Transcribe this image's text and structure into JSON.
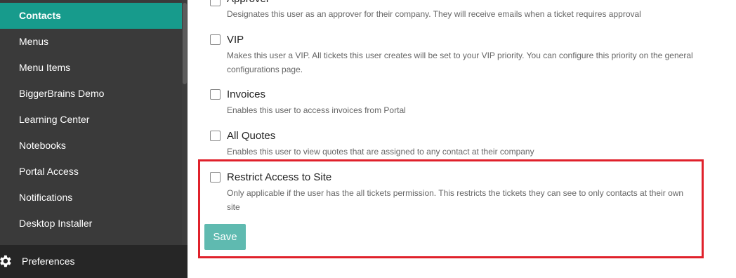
{
  "sidebar": {
    "items": [
      {
        "label": "Contacts",
        "active": true
      },
      {
        "label": "Menus"
      },
      {
        "label": "Menu Items"
      },
      {
        "label": "BiggerBrains Demo"
      },
      {
        "label": "Learning Center"
      },
      {
        "label": "Notebooks"
      },
      {
        "label": "Portal Access"
      },
      {
        "label": "Notifications"
      },
      {
        "label": "Desktop Installer"
      }
    ],
    "preferences": {
      "label": "Preferences",
      "icon": "gear-icon"
    }
  },
  "options": [
    {
      "title": "Approver",
      "description": "Designates this user as an approver for their company. They will receive emails when a ticket requires approval",
      "checked": false
    },
    {
      "title": "VIP",
      "description": "Makes this user a VIP. All tickets this user creates will be set to your VIP priority. You can configure this priority on the general configurations page.",
      "checked": false
    },
    {
      "title": "Invoices",
      "description": "Enables this user to access invoices from Portal",
      "checked": false
    },
    {
      "title": "All Quotes",
      "description": "Enables this user to view quotes that are assigned to any contact at their company",
      "checked": false
    },
    {
      "title": "Restrict Access to Site",
      "description": "Only applicable if the user has the all tickets permission. This restricts the tickets they can see to only contacts at their own site",
      "checked": false
    }
  ],
  "save_label": "Save",
  "colors": {
    "accent": "#179b8c",
    "save": "#5fbab0",
    "highlight": "#e0212b"
  }
}
